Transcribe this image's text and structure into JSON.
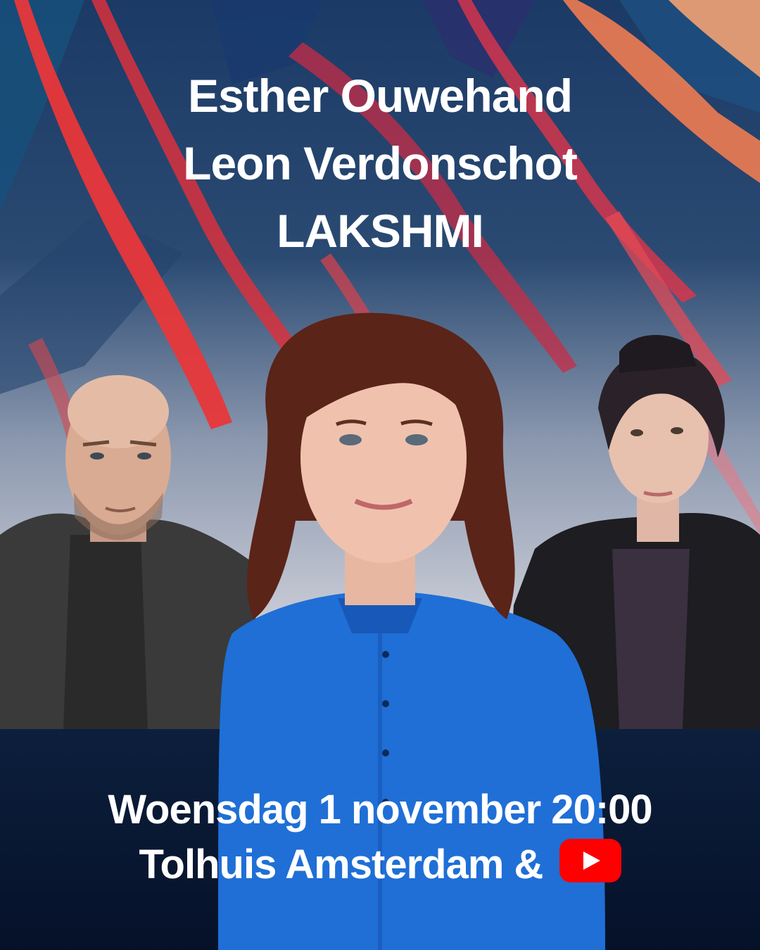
{
  "headline": {
    "names": [
      "Esther Ouwehand",
      "Leon Verdonschot",
      "LAKSHMI"
    ]
  },
  "event": {
    "datetime": "Woensdag 1 november 20:00",
    "location": "Tolhuis Amsterdam &"
  },
  "icons": {
    "stream": "youtube-play-icon"
  },
  "colors": {
    "band": "#0b1c38",
    "text": "#ffffff",
    "accent_red": "#ff0000",
    "shirt_blue": "#1f6fd6"
  }
}
